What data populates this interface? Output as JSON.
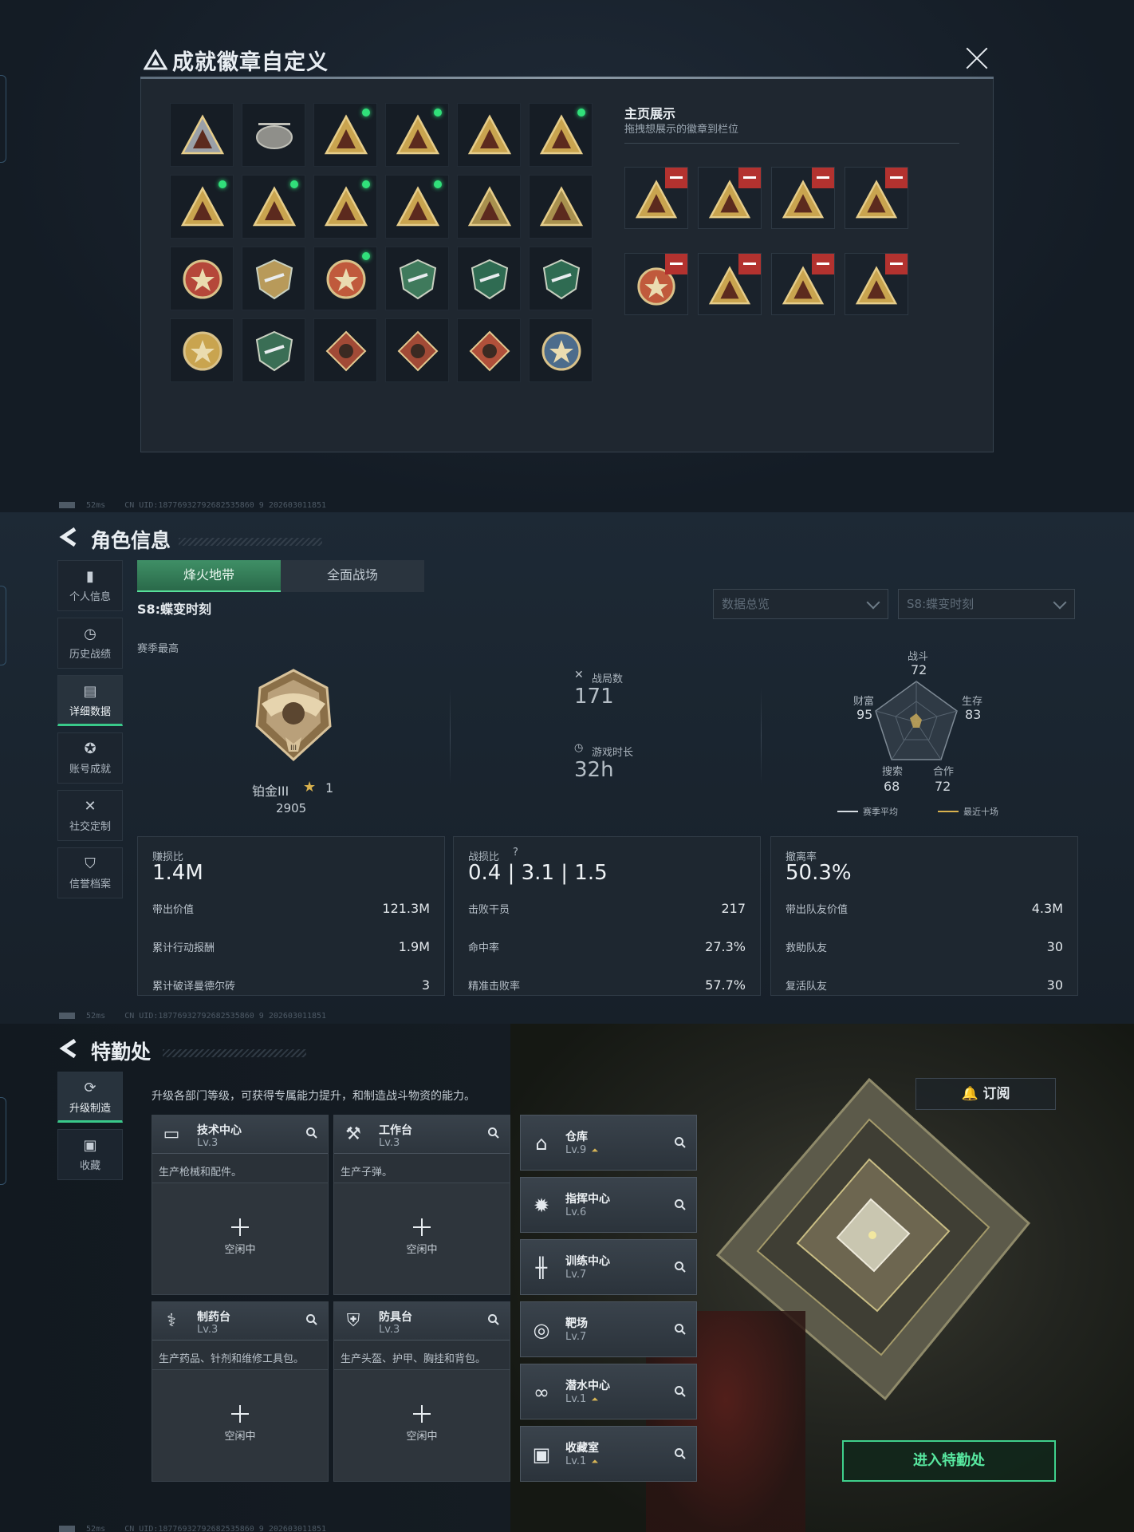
{
  "badge_dialog": {
    "title": "成就徽章自定义",
    "showcase_title": "主页展示",
    "showcase_sub": "拖拽想展示的徽章到栏位",
    "badges": [
      {
        "icon": "delta-triangle-badge-icon",
        "new": false,
        "color": "#9aa0a8"
      },
      {
        "icon": "helicopter-badge-icon",
        "new": false,
        "color": "#8f8f8a"
      },
      {
        "icon": "skull-triangle-badge-icon",
        "new": true,
        "color": "#c9a44f"
      },
      {
        "icon": "tower-triangle-badge-icon",
        "new": true,
        "color": "#c9a44f"
      },
      {
        "icon": "s8-triangle-badge-icon",
        "new": false,
        "color": "#c9a44f"
      },
      {
        "icon": "helmet-triangle-badge-icon",
        "new": true,
        "color": "#c9a44f"
      },
      {
        "icon": "number-one-triangle-badge-icon",
        "new": true,
        "color": "#c9a44f"
      },
      {
        "icon": "bottle-triangle-badge-icon",
        "new": true,
        "color": "#c9a44f"
      },
      {
        "icon": "soldier-triangle-badge-icon",
        "new": true,
        "color": "#c9a44f"
      },
      {
        "icon": "emblem-triangle-badge-icon",
        "new": true,
        "color": "#c9a44f"
      },
      {
        "icon": "runner-triangle-badge-icon",
        "new": false,
        "color": "#a8904e"
      },
      {
        "icon": "rocket-triangle-badge-icon",
        "new": false,
        "color": "#a8904e"
      },
      {
        "icon": "star-medal-badge-icon",
        "new": false,
        "color": "#b5473a"
      },
      {
        "icon": "shield-badge-icon",
        "new": false,
        "color": "#b89a5a"
      },
      {
        "icon": "eagle-medal-badge-icon",
        "new": true,
        "color": "#c05a3c"
      },
      {
        "icon": "green-shield-badge-icon",
        "new": false,
        "color": "#3f7a5c"
      },
      {
        "icon": "green-rifle-badge-icon",
        "new": false,
        "color": "#2f6b52"
      },
      {
        "icon": "green-gun-badge-icon",
        "new": false,
        "color": "#2f6b52"
      },
      {
        "icon": "crossed-swords-badge-icon",
        "new": false,
        "color": "#c9a44f"
      },
      {
        "icon": "green-hex-badge-icon",
        "new": false,
        "color": "#3a6e55"
      },
      {
        "icon": "dragon-diamond-badge-icon",
        "new": false,
        "color": "#a14a36"
      },
      {
        "icon": "dragon-diamond-2-badge-icon",
        "new": false,
        "color": "#a14a36"
      },
      {
        "icon": "runner-diamond-badge-icon",
        "new": false,
        "color": "#b0503a"
      },
      {
        "icon": "horse-round-badge-icon",
        "new": false,
        "color": "#4c6c8c"
      }
    ],
    "slots": [
      {
        "icon": "skull-triangle-badge-icon"
      },
      {
        "icon": "tower-triangle-badge-icon"
      },
      {
        "icon": "helmet-triangle-badge-icon"
      },
      {
        "icon": "number-one-triangle-badge-icon"
      },
      {
        "icon": "eagle-medal-badge-icon"
      },
      {
        "icon": "soldier-triangle-badge-icon"
      },
      {
        "icon": "emblem-triangle-badge-icon"
      },
      {
        "icon": "bottle-triangle-badge-icon"
      }
    ]
  },
  "status_bar": {
    "ping": "52ms",
    "uid": "CN UID:18776932792682535860 9 202603011851"
  },
  "character": {
    "title": "角色信息",
    "nav": [
      {
        "label": "个人信息",
        "icon": "bar-chart-icon",
        "active": false
      },
      {
        "label": "历史战绩",
        "icon": "clock-icon",
        "active": false
      },
      {
        "label": "详细数据",
        "icon": "folder-icon",
        "active": true
      },
      {
        "label": "账号成就",
        "icon": "medal-icon",
        "active": false
      },
      {
        "label": "社交定制",
        "icon": "tools-icon",
        "active": false
      },
      {
        "label": "信誉档案",
        "icon": "badge-shield-icon",
        "active": false
      }
    ],
    "tabs": [
      "烽火地带",
      "全面战场"
    ],
    "season": "S8:蝶变时刻",
    "dropdown_view": "数据总览",
    "dropdown_season": "S8:蝶变时刻",
    "season_best_label": "赛季最高",
    "rank_name": "铂金III",
    "rank_stars": "1",
    "rank_score": "2905",
    "matches_label": "战局数",
    "matches": "171",
    "playtime_label": "游戏时长",
    "playtime": "32h",
    "radar": {
      "labels": {
        "combat": "战斗",
        "survival": "生存",
        "cooperate": "合作",
        "search": "搜索",
        "wealth": "财富"
      },
      "values": {
        "combat": "72",
        "survival": "83",
        "cooperate": "72",
        "search": "68",
        "wealth": "95"
      },
      "legend_avg": "赛季平均",
      "legend_recent": "最近十场"
    },
    "cards": [
      {
        "title": "赚损比",
        "big": "1.4M",
        "rows": [
          {
            "k": "带出价值",
            "v": "121.3M"
          },
          {
            "k": "累计行动报酬",
            "v": "1.9M"
          },
          {
            "k": "累计破译曼德尔砖",
            "v": "3"
          }
        ]
      },
      {
        "title": "战损比",
        "big": "0.4 | 3.1 | 1.5",
        "rows": [
          {
            "k": "击败干员",
            "v": "217"
          },
          {
            "k": "命中率",
            "v": "27.3%"
          },
          {
            "k": "精准击败率",
            "v": "57.7%"
          }
        ]
      },
      {
        "title": "撤离率",
        "big": "50.3%",
        "rows": [
          {
            "k": "带出队友价值",
            "v": "4.3M"
          },
          {
            "k": "救助队友",
            "v": "30"
          },
          {
            "k": "复活队友",
            "v": "30"
          }
        ]
      }
    ]
  },
  "special_ops": {
    "title": "特勤处",
    "nav": [
      {
        "label": "升级制造",
        "icon": "upgrade-icon",
        "active": true
      },
      {
        "label": "收藏",
        "icon": "collection-icon",
        "active": false
      }
    ],
    "intro": "升级各部门等级，可获得专属能力提升，和制造战斗物资的能力。",
    "facilities": [
      {
        "name": "技术中心",
        "level": "Lv.3",
        "desc": "生产枪械和配件。",
        "status": "空闲中",
        "icon": "monitor-icon"
      },
      {
        "name": "工作台",
        "level": "Lv.3",
        "desc": "生产子弹。",
        "status": "空闲中",
        "icon": "hammer-icon"
      },
      {
        "name": "制药台",
        "level": "Lv.3",
        "desc": "生产药品、针剂和维修工具包。",
        "status": "空闲中",
        "icon": "syringe-icon"
      },
      {
        "name": "防具台",
        "level": "Lv.3",
        "desc": "生产头盔、护甲、胸挂和背包。",
        "status": "空闲中",
        "icon": "armor-icon"
      }
    ],
    "right_facilities": [
      {
        "name": "仓库",
        "level": "Lv.9",
        "up": true,
        "icon": "warehouse-icon"
      },
      {
        "name": "指挥中心",
        "level": "Lv.6",
        "up": false,
        "icon": "command-icon"
      },
      {
        "name": "训练中心",
        "level": "Lv.7",
        "up": false,
        "icon": "dumbbell-icon"
      },
      {
        "name": "靶场",
        "level": "Lv.7",
        "up": false,
        "icon": "target-icon"
      },
      {
        "name": "潜水中心",
        "level": "Lv.1",
        "up": true,
        "icon": "diving-goggles-icon"
      },
      {
        "name": "收藏室",
        "level": "Lv.1",
        "up": true,
        "icon": "display-case-icon"
      }
    ],
    "subscribe": "订阅",
    "enter": "进入特勤处"
  }
}
